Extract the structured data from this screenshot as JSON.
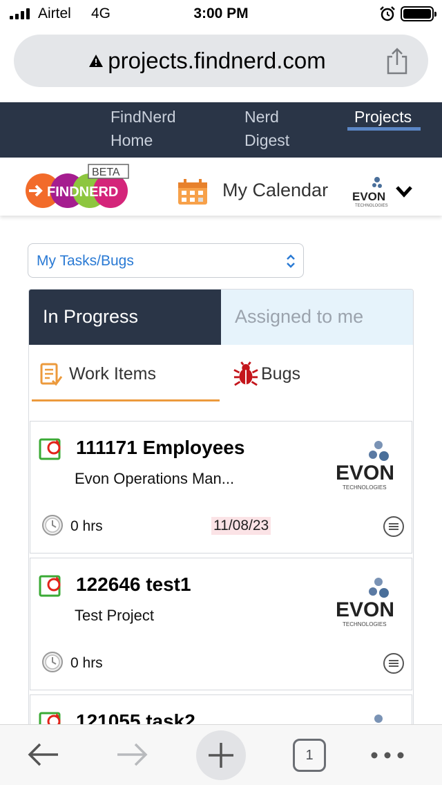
{
  "status_bar": {
    "carrier": "Airtel",
    "network": "4G",
    "time": "3:00 PM",
    "icons": [
      "signal-icon",
      "alarm-icon",
      "battery-icon"
    ]
  },
  "browser": {
    "url": "projects.findnerd.com",
    "icons": [
      "warning-icon",
      "share-icon"
    ]
  },
  "topnav": {
    "items": [
      {
        "label_line1": "FindNerd",
        "label_line2": "Home"
      },
      {
        "label_line1": "Nerd",
        "label_line2": "Digest"
      },
      {
        "label_line1": "Projects",
        "label_line2": "",
        "active": true
      }
    ]
  },
  "header": {
    "logo_text": "FINDNERD",
    "logo_badge": "BETA",
    "calendar_label": "My Calendar",
    "company_logo": "EVON",
    "company_tagline": "TECHNOLOGIES"
  },
  "filter": {
    "selected": "My Tasks/Bugs"
  },
  "tabs": {
    "primary": [
      "In Progress",
      "Assigned to me"
    ],
    "secondary": [
      "Work Items",
      "Bugs"
    ]
  },
  "cards": [
    {
      "title": "111171 Employees",
      "project": "Evon Operations Man...",
      "hours": "0 hrs",
      "date": "11/08/23"
    },
    {
      "title": "122646 test1",
      "project": "Test Project",
      "hours": "0 hrs",
      "date": ""
    },
    {
      "title": "121055 task2",
      "project": "",
      "hours": "",
      "date": ""
    }
  ],
  "toolbar": {
    "tab_count": "1",
    "icons": [
      "back-arrow-icon",
      "forward-arrow-icon",
      "plus-icon",
      "tabs-icon",
      "more-icon"
    ]
  },
  "colors": {
    "nav_bg": "#2a3547",
    "accent_blue": "#2a7ad4",
    "tab_active_underline": "#ec9a3c",
    "date_highlight": "#fbe3e6"
  }
}
